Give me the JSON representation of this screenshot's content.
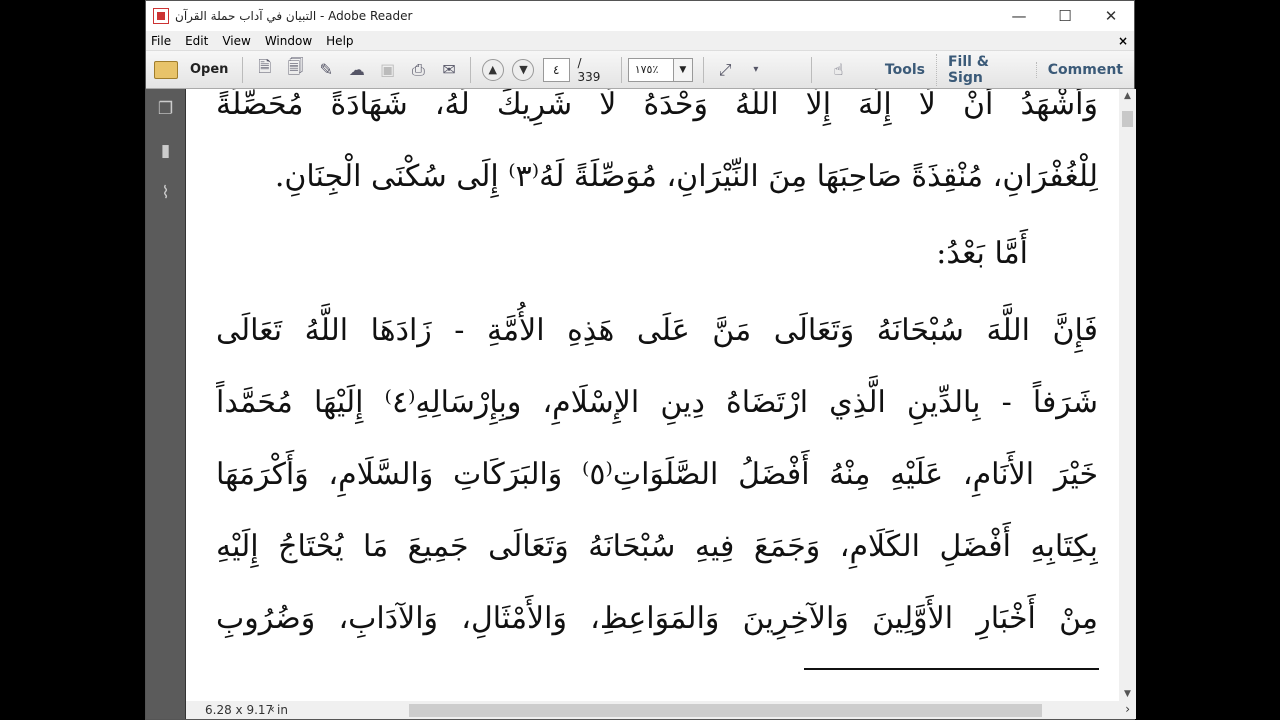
{
  "window": {
    "title": "التبيان في آداب حملة القرآن - Adobe Reader"
  },
  "menu": [
    "File",
    "Edit",
    "View",
    "Window",
    "Help"
  ],
  "toolbar": {
    "open_label": "Open",
    "page_current": "٤",
    "page_total": "/ 339",
    "zoom": "١٧٥٪",
    "tools": "Tools",
    "fill_sign": "Fill & Sign",
    "comment": "Comment"
  },
  "document": {
    "lines": [
      "وَأَشْهَدُ أَنْ لَا إِلَهَ إِلَّا اللَّهُ وَحْدَهُ لَا شَرِيكَ لَهُ، شَهَادَةً مُحَصِّلَةً",
      "لِلْغُفْرَانِ، مُنْقِذَةً صَاحِبَهَا مِنَ النِّيْرَانِ، مُوَصِّلَةً لَهُ⁽٣⁾ إِلَى سُكْنَى الْجِنَانِ.",
      "أَمَّا بَعْدُ:",
      "فَإِنَّ اللَّهَ سُبْحَانَهُ وَتَعَالَى مَنَّ عَلَى هَذِهِ الأُمَّةِ - زَادَهَا اللَّهُ تَعَالَى",
      "شَرَفاً - بِالدِّينِ الَّذِي ارْتَضَاهُ دِينِ الإِسْلَامِ، وبِإِرْسَالِهِ⁽٤⁾ إِلَيْهَا مُحَمَّداً",
      "خَيْرَ الأَنَامِ، عَلَيْهِ مِنْهُ أَفْضَلُ الصَّلَوَاتِ⁽٥⁾ وَالبَرَكَاتِ وَالسَّلَامِ، وَأَكْرَمَهَا",
      "بِكِتَابِهِ أَفْضَلِ الكَلَامِ، وَجَمَعَ فِيهِ سُبْحَانَهُ وَتَعَالَى جَمِيعَ مَا يُحْتَاجُ إِلَيْهِ",
      "مِنْ أَخْبَارِ الأَوَّلِينَ وَالآخِرِينَ وَالمَوَاعِظِ، وَالأَمْثَالِ، وَالآدَابِ، وَضُرُوبِ"
    ]
  },
  "status": {
    "page_size": "6.28 x 9.17 in"
  }
}
